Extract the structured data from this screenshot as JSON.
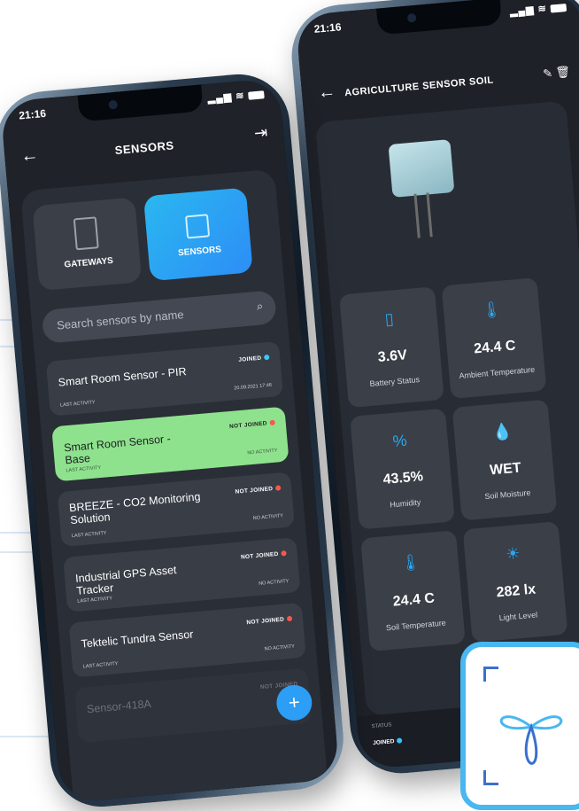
{
  "left_phone": {
    "status_time": "21:16",
    "title": "SENSORS",
    "tabs": [
      {
        "label": "GATEWAYS",
        "active": false
      },
      {
        "label": "SENSORS",
        "active": true
      }
    ],
    "search": {
      "placeholder": "Search sensors by name"
    },
    "sensors": [
      {
        "name": "Smart Room Sensor - PIR",
        "status": "JOINED",
        "status_color": "#3ec5f5",
        "last_activity_label": "LAST ACTIVITY",
        "last_activity": "20.09.2021   17:46"
      },
      {
        "name": "Smart Room Sensor - Base",
        "status": "NOT JOINED",
        "status_color": "#f5594e",
        "last_activity_label": "LAST ACTIVITY",
        "last_activity": "NO ACTIVITY"
      },
      {
        "name": "BREEZE - CO2 Monitoring Solution",
        "status": "NOT JOINED",
        "status_color": "#f5594e",
        "last_activity_label": "LAST ACTIVITY",
        "last_activity": "NO ACTIVITY"
      },
      {
        "name": "Industrial GPS Asset Tracker",
        "status": "NOT JOINED",
        "status_color": "#f5594e",
        "last_activity_label": "LAST ACTIVITY",
        "last_activity": "NO ACTIVITY"
      },
      {
        "name": "Tektelic Tundra Sensor",
        "status": "NOT JOINED",
        "status_color": "#f5594e",
        "last_activity_label": "LAST ACTIVITY",
        "last_activity": "NO ACTIVITY"
      },
      {
        "name": "Sensor-418A",
        "status": "NOT JOINED",
        "status_color": "#f5594e",
        "last_activity_label": "",
        "last_activity": ""
      }
    ],
    "fab_label": "+"
  },
  "right_phone": {
    "status_time": "21:16",
    "title": "AGRICULTURE SENSOR SOIL",
    "metrics": [
      {
        "icon": "battery-icon",
        "value": "3.6V",
        "label": "Battery Status"
      },
      {
        "icon": "thermometer-icon",
        "value": "24.4 C",
        "label": "Ambient Temperature"
      },
      {
        "icon": "humidity-icon",
        "value": "43.5%",
        "label": "Humidity"
      },
      {
        "icon": "water-drop-icon",
        "value": "WET",
        "label": "Soil Moisture"
      },
      {
        "icon": "thermometer-icon",
        "value": "24.4 C",
        "label": "Soil Temperature"
      },
      {
        "icon": "light-bulb-icon",
        "value": "282 lx",
        "label": "Light Level"
      }
    ],
    "status_label": "STATUS",
    "status_value": "JOINED"
  },
  "colors": {
    "accent": "#2d9ef6",
    "selected_card": "#8ee28d",
    "joined": "#3ec5f5",
    "not_joined": "#f5594e"
  }
}
